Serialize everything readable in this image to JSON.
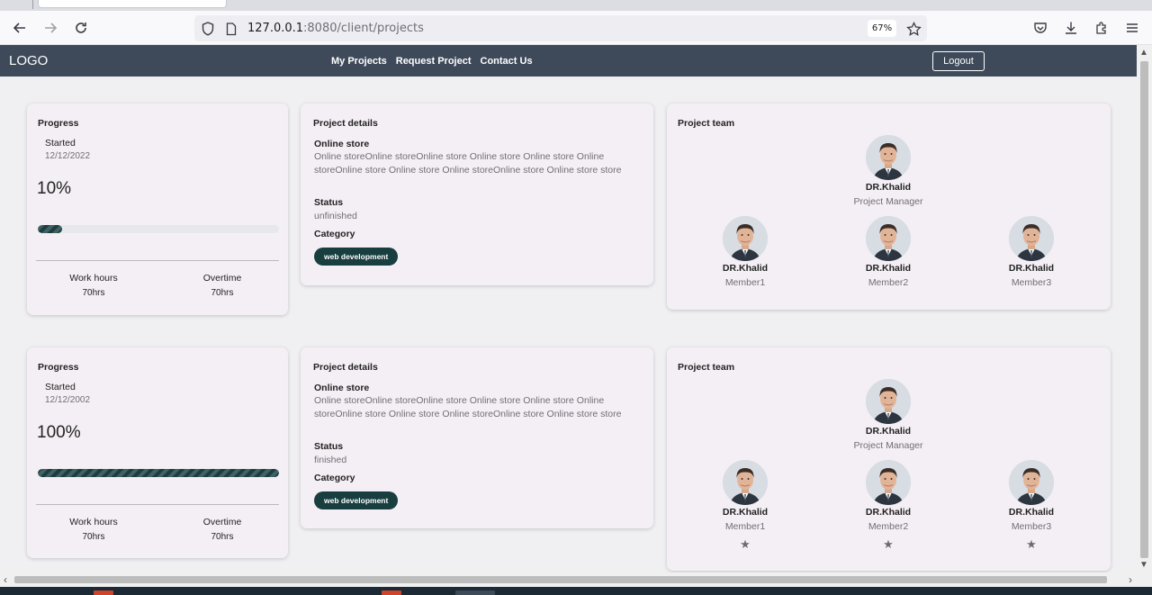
{
  "browser": {
    "url_host": "127.0.0.1",
    "url_path": ":8080/client/projects",
    "zoom": "67%"
  },
  "nav": {
    "logo": "LOGO",
    "links": [
      "My Projects",
      "Request Project",
      "Contact Us"
    ],
    "logout": "Logout"
  },
  "projects": [
    {
      "progress": {
        "title": "Progress",
        "started_label": "Started",
        "started_date": "12/12/2022",
        "percent_text": "10%",
        "percent_value": 0.1,
        "work_hours_label": "Work hours",
        "work_hours": "70hrs",
        "overtime_label": "Overtime",
        "overtime": "70hrs"
      },
      "details": {
        "title": "Project details",
        "name": "Online store",
        "description": "Online storeOnline storeOnline store Online store Online store Online storeOnline store Online store Online storeOnline store Online store store",
        "status_label": "Status",
        "status": "unfinished",
        "category_label": "Category",
        "category": "web development"
      },
      "team": {
        "title": "Project team",
        "manager": {
          "name": "DR.Khalid",
          "role": "Project Manager"
        },
        "members": [
          {
            "name": "DR.Khalid",
            "role": "Member1"
          },
          {
            "name": "DR.Khalid",
            "role": "Member2"
          },
          {
            "name": "DR.Khalid",
            "role": "Member3"
          }
        ],
        "show_stars": false
      }
    },
    {
      "progress": {
        "title": "Progress",
        "started_label": "Started",
        "started_date": "12/12/2002",
        "percent_text": "100%",
        "percent_value": 1.0,
        "work_hours_label": "Work hours",
        "work_hours": "70hrs",
        "overtime_label": "Overtime",
        "overtime": "70hrs"
      },
      "details": {
        "title": "Project details",
        "name": "Online store",
        "description": "Online storeOnline storeOnline store Online store Online store Online storeOnline store Online store Online storeOnline store Online store store",
        "status_label": "Status",
        "status": "finished",
        "category_label": "Category",
        "category": "web development"
      },
      "team": {
        "title": "Project team",
        "manager": {
          "name": "DR.Khalid",
          "role": "Project Manager"
        },
        "members": [
          {
            "name": "DR.Khalid",
            "role": "Member1"
          },
          {
            "name": "DR.Khalid",
            "role": "Member2"
          },
          {
            "name": "DR.Khalid",
            "role": "Member3"
          }
        ],
        "show_stars": true
      }
    }
  ]
}
